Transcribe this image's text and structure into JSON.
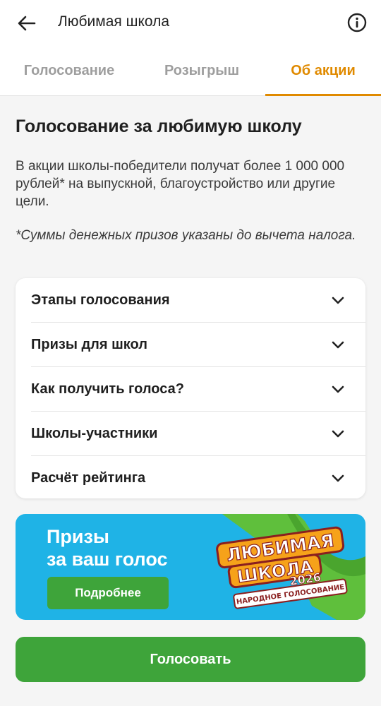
{
  "header": {
    "title": "Любимая школа",
    "back_icon": "arrow-left-icon",
    "info_icon": "info-circle-icon"
  },
  "tabs": [
    {
      "label": "Голосование",
      "active": false
    },
    {
      "label": "Розыгрыш",
      "active": false
    },
    {
      "label": "Об акции",
      "active": true
    }
  ],
  "content": {
    "heading": "Голосование за любимую школу",
    "description": "В акции школы-победители получат более 1 000 000 рублей* на выпускной, благоустройство или другие цели.",
    "note": "*Суммы денежных призов указаны до вычета налога."
  },
  "accordion": [
    {
      "label": "Этапы голосования"
    },
    {
      "label": "Призы для школ"
    },
    {
      "label": "Как получить голоса?"
    },
    {
      "label": "Школы-участники"
    },
    {
      "label": "Расчёт рейтинга"
    }
  ],
  "banner": {
    "title_line1": "Призы",
    "title_line2": "за ваш голос",
    "button_label": "Подробнее",
    "logo_line1": "ЛЮБИМАЯ",
    "logo_line2": "ШКОЛА",
    "logo_year": "2026",
    "logo_ribbon": "НАРОДНОЕ ГОЛОСОВАНИЕ"
  },
  "vote_button": {
    "label": "Голосовать"
  },
  "colors": {
    "accent": "#e08a00",
    "primary_green": "#3ea43a",
    "banner_blue": "#1fb3e6"
  }
}
